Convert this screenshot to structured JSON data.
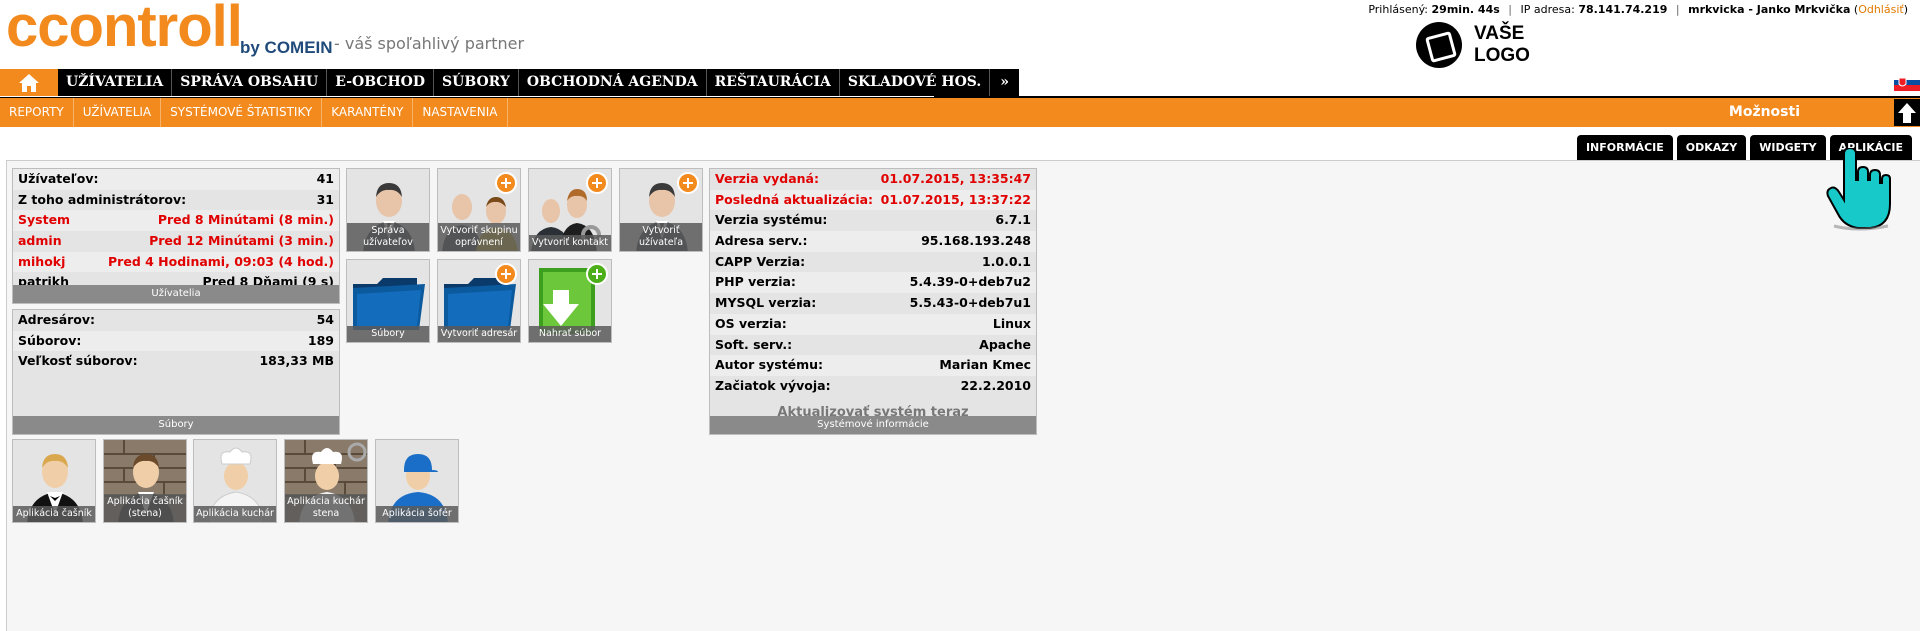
{
  "header": {
    "logo_main": "ccontroll",
    "logo_by": "by COMEIN",
    "tagline": "- váš spoľahlivý partner",
    "logged_label": "Prihlásený:",
    "logged_value": "29min. 44s",
    "ip_label": "IP adresa:",
    "ip_value": "78.141.74.219",
    "user": "mrkvicka - Janko Mrkvička",
    "logout": "Odhlásiť",
    "logo_placeholder_line1": "VAŠE",
    "logo_placeholder_line2": "LOGO"
  },
  "mainnav": {
    "items": [
      "UŽÍVATELIA",
      "SPRÁVA OBSAHU",
      "E-OBCHOD",
      "SÚBORY",
      "OBCHODNÁ AGENDA",
      "REŠTAURÁCIA",
      "SKLADOVÉ HOS.",
      "»"
    ]
  },
  "subnav": {
    "items": [
      "REPORTY",
      "UŽÍVATELIA",
      "SYSTÉMOVÉ ŠTATISTIKY",
      "KARANTÉNY",
      "NASTAVENIA"
    ],
    "options": "Možnosti"
  },
  "tabs": [
    "INFORMÁCIE",
    "ODKAZY",
    "WIDGETY",
    "APLIKÁCIE"
  ],
  "users_panel": {
    "rows": [
      {
        "label": "Užívateľov:",
        "value": "41",
        "red": false
      },
      {
        "label": "Z toho administrátorov:",
        "value": "31",
        "red": false
      },
      {
        "label": "System",
        "value": "Pred 8 Minútami (8 min.)",
        "red": true
      },
      {
        "label": "admin",
        "value": "Pred 12 Minútami (3 min.)",
        "red": true
      },
      {
        "label": "mihokj",
        "value": "Pred 4 Hodinami, 09:03 (4 hod.)",
        "red": true
      },
      {
        "label": "patrikh",
        "value": "Pred 8 Dňami (9 s)",
        "red": false
      }
    ],
    "footer": "Užívatelia"
  },
  "files_panel": {
    "rows": [
      {
        "label": "Adresárov:",
        "value": "54"
      },
      {
        "label": "Súborov:",
        "value": "189"
      },
      {
        "label": "Veľkosť súborov:",
        "value": "183,33 MB"
      }
    ],
    "footer": "Súbory"
  },
  "tiles_top": [
    "Správa užívateľov",
    "Vytvoriť skupinu oprávnení",
    "Vytvoriť kontakt",
    "Vytvoriť užívateľa",
    "Súbory",
    "Vytvoriť adresár",
    "Nahrať súbor"
  ],
  "sysinfo_panel": {
    "rows": [
      {
        "label": "Verzia vydaná:",
        "value": "01.07.2015, 13:35:47",
        "red": true
      },
      {
        "label": "Posledná aktualizácia:",
        "value": "01.07.2015, 13:37:22",
        "red": true
      },
      {
        "label": "Verzia systému:",
        "value": "6.7.1",
        "red": false
      },
      {
        "label": "Adresa serv.:",
        "value": "95.168.193.248",
        "red": false
      },
      {
        "label": "CAPP Verzia:",
        "value": "1.0.0.1",
        "red": false
      },
      {
        "label": "PHP verzia:",
        "value": "5.4.39-0+deb7u2",
        "red": false
      },
      {
        "label": "MYSQL verzia:",
        "value": "5.5.43-0+deb7u1",
        "red": false
      },
      {
        "label": "OS verzia:",
        "value": "Linux",
        "red": false
      },
      {
        "label": "Soft. serv.:",
        "value": "Apache",
        "red": false
      },
      {
        "label": "Autor systému:",
        "value": "Marian Kmec",
        "red": false
      },
      {
        "label": "Začiatok vývoja:",
        "value": "22.2.2010",
        "red": false
      }
    ],
    "update": "Aktualizovať systém teraz",
    "footer": "Systémové informácie"
  },
  "tiles_bottom": [
    "Aplikácia čašník",
    "Aplikácia čašník (stena)",
    "Aplikácia kuchár",
    "Aplikácia kuchár stena",
    "Aplikácia šofér"
  ],
  "colors": {
    "orange": "#f28a1e",
    "black": "#000000",
    "red": "#e10000"
  }
}
